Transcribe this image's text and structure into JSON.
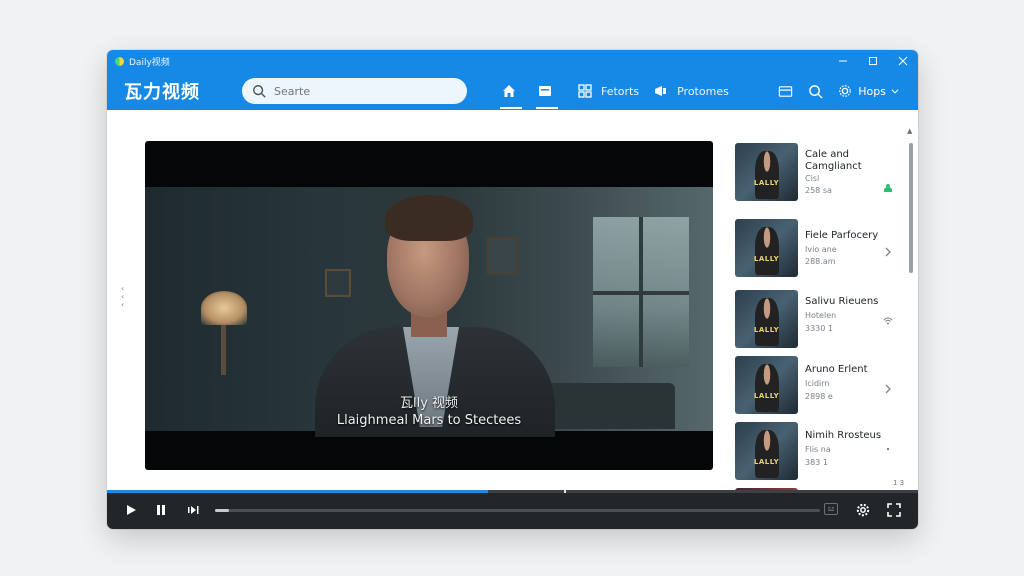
{
  "window": {
    "title": "Daily视频",
    "controls": {
      "minimize": "—",
      "maximize": "☐",
      "close": "✕"
    }
  },
  "header": {
    "logo": "瓦力视频",
    "search_placeholder": "Searte",
    "nav_text": [
      "Fetorts",
      "Protomes"
    ],
    "hops_label": "Hops",
    "accent_color": "#1689e6"
  },
  "player": {
    "subtitle_line1": "瓦lly 视频",
    "subtitle_line2": "Llaighmeal Mars to Stectees",
    "progress_fraction": 0.47
  },
  "related": [
    {
      "title": "Cale and Camglianct",
      "sub1": "Cisl",
      "sub2": "258 sa",
      "thumb_title": "LALLY",
      "indicator": "status-icon",
      "indicator_color": "#2fbf71"
    },
    {
      "title": "Fiele Parfocery",
      "sub1": "Ivio ane",
      "sub2": "288.am",
      "thumb_title": "LALLY",
      "indicator": "chevron-right-icon"
    },
    {
      "title": "Salivu Rieuens",
      "sub1": "Hotelen",
      "sub2": "3330 1",
      "thumb_title": "LALLY",
      "indicator": "wifi-icon"
    },
    {
      "title": "Aruno Erlent",
      "sub1": "Icidirn",
      "sub2": "2898 e",
      "thumb_title": "LALLY",
      "indicator": "chevron-right-icon"
    },
    {
      "title": "Nimih Rrosteus",
      "sub1": "Flis na",
      "sub2": "383 1",
      "thumb_title": "LALLY",
      "indicator": "dot-icon"
    }
  ],
  "scroll": {
    "down_label": "1 3"
  }
}
